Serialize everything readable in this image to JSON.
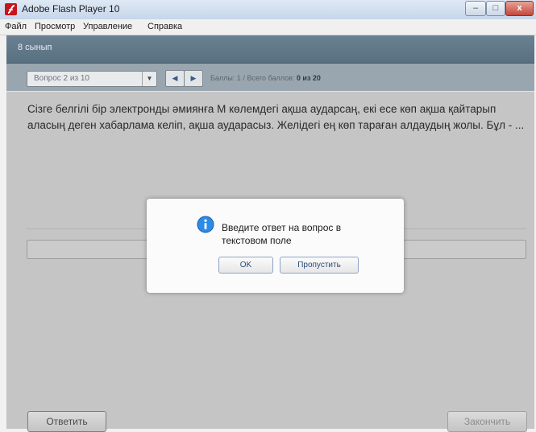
{
  "window": {
    "title": "Adobe Flash Player 10",
    "minimize_label": "–",
    "maximize_label": "□",
    "close_label": "x"
  },
  "menu": [
    "Файл",
    "Просмотр",
    "Управление",
    "Справка"
  ],
  "header": {
    "label": "8 сынып"
  },
  "toolbar": {
    "question_select_value": "Вопрос 2 из 10",
    "select_arrow": "▼",
    "prev_label": "◀",
    "next_label": "▶",
    "score_label": "Баллы: 1",
    "score_separator": "/",
    "total_label": "Всего баллов:",
    "total_value": "0 из 20"
  },
  "question": {
    "text": "Сізге белгілі бір электронды әмиянға М көлемдегі ақша аударсаң, екі есе көп ақша қайтарып аласың деген хабарлама келіп, ақша аударасыз. Желідегі ең көп тараған алдаудың жолы. Бұл - ...",
    "answer_value": ""
  },
  "buttons": {
    "answer": "Ответить",
    "finish": "Закончить"
  },
  "dialog": {
    "message": "Введите ответ на вопрос в текстовом поле",
    "ok": "OK",
    "skip": "Пропустить"
  },
  "colors": {
    "header": "#5f7686",
    "toolbar": "#9aa6af",
    "content_dimmed": "#c5c5c5",
    "dialog_button_text": "#2c4a79",
    "info_icon": "#2b8be6"
  }
}
